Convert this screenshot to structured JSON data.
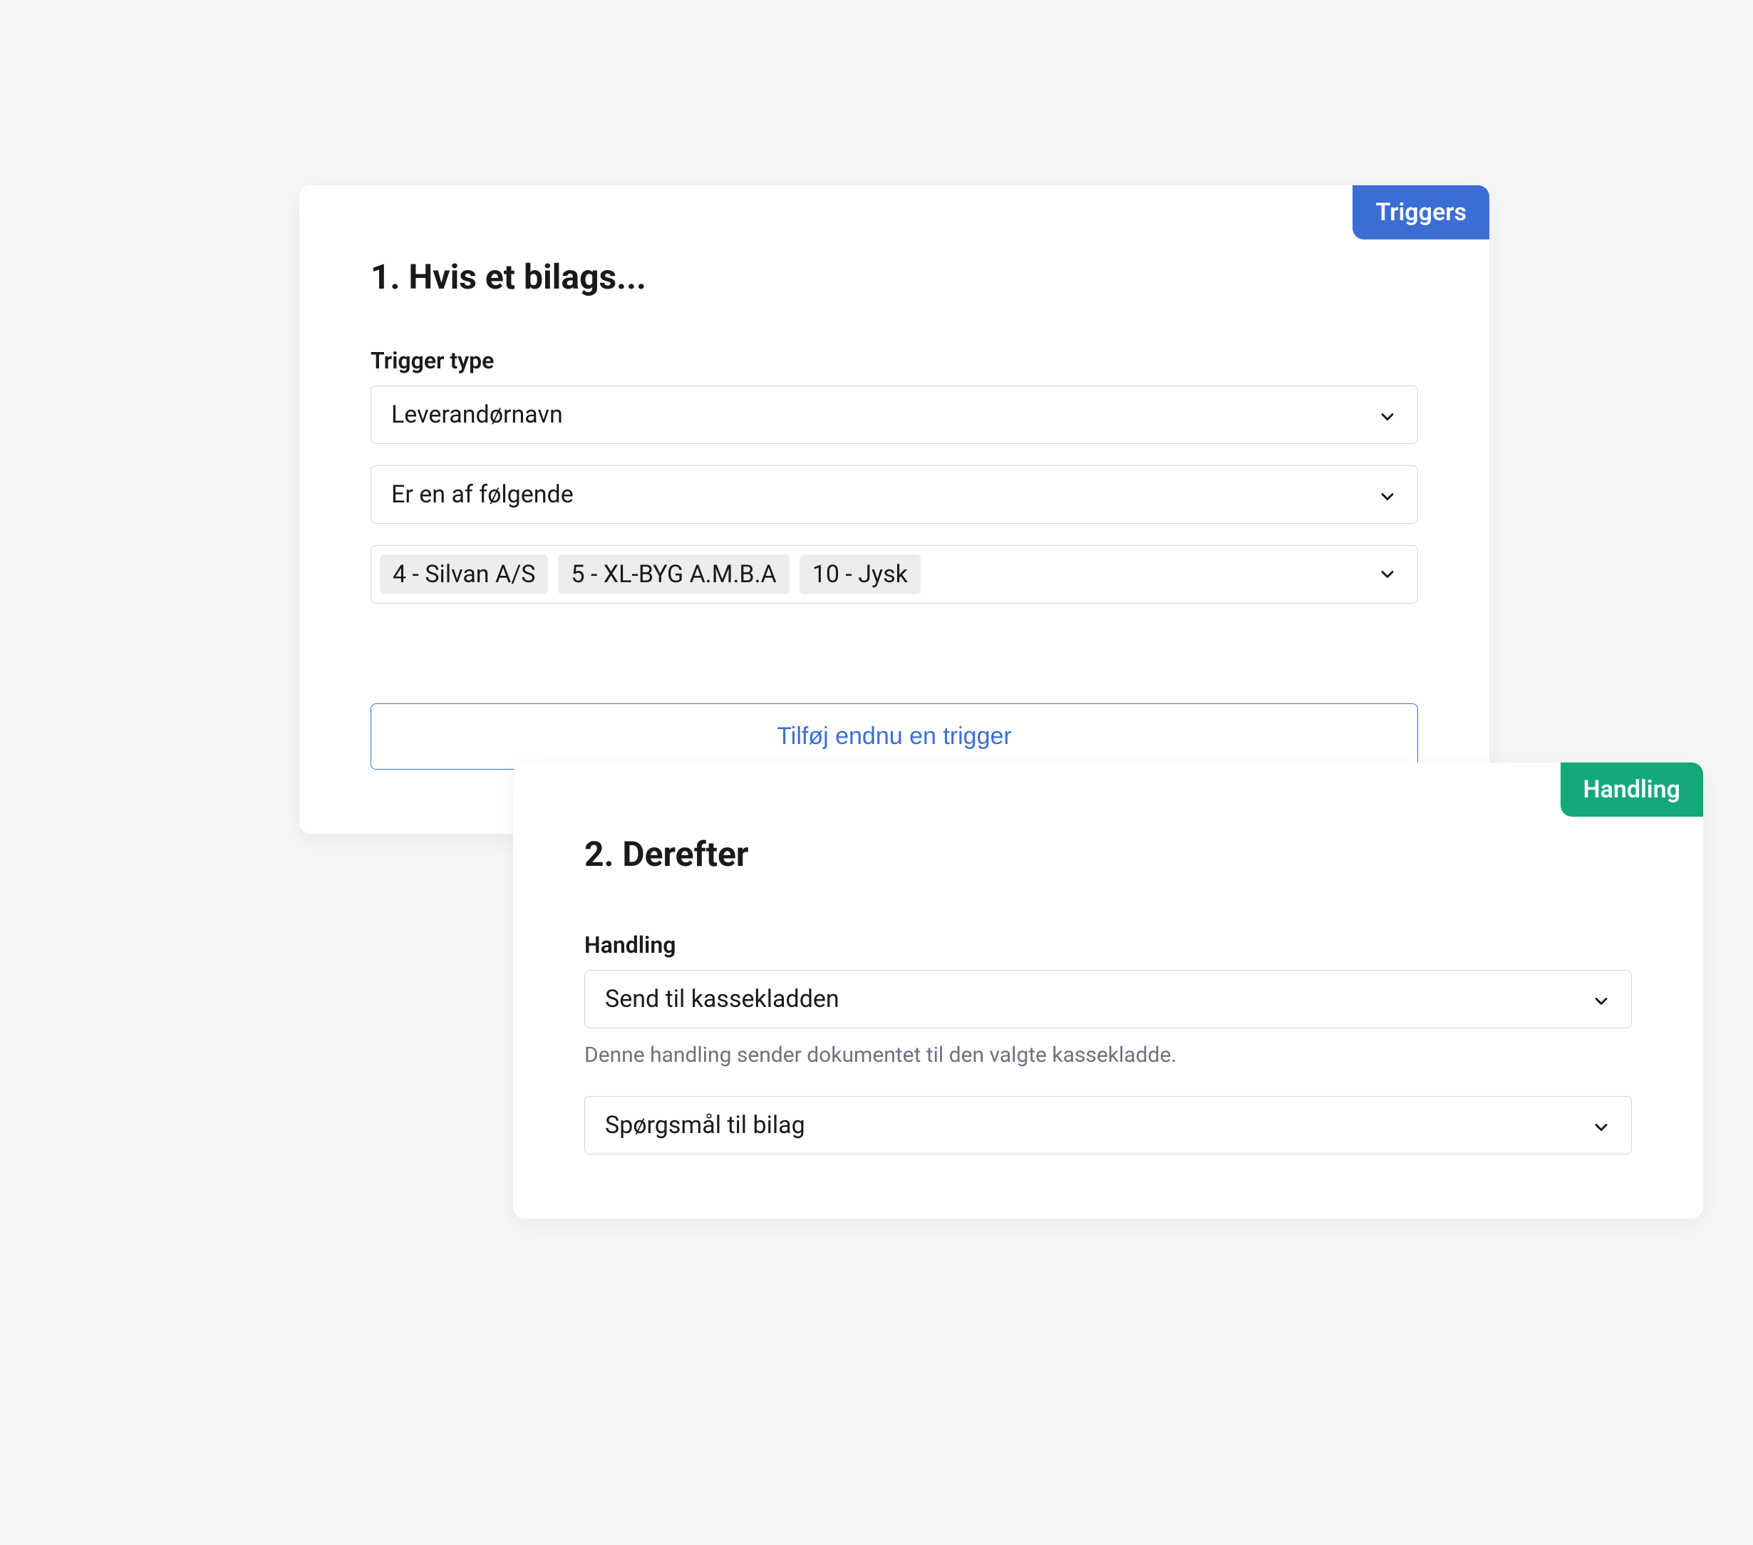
{
  "triggers_card": {
    "badge": "Triggers",
    "title": "1. Hvis et bilags...",
    "trigger_type_label": "Trigger type",
    "trigger_type_value": "Leverandørnavn",
    "condition_value": "Er en af følgende",
    "supplier_chips": [
      "4 - Silvan A/S",
      "5 - XL-BYG A.M.B.A",
      "10 - Jysk"
    ],
    "add_trigger_button": "Tilføj endnu en trigger"
  },
  "handling_card": {
    "badge": "Handling",
    "title": "2. Derefter",
    "action_label": "Handling",
    "action_value": "Send til kassekladden",
    "action_help": "Denne handling sender dokumentet til den valgte kassekladde.",
    "target_value": "Spørgsmål til bilag"
  }
}
